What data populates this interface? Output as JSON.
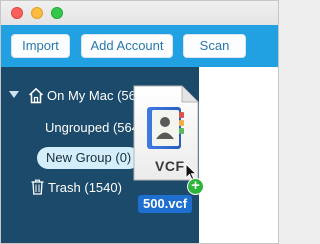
{
  "window": {
    "controls": [
      "close",
      "minimize",
      "zoom"
    ]
  },
  "toolbar": {
    "import_label": "Import",
    "add_account_label": "Add Account",
    "scan_label": "Scan"
  },
  "sidebar": {
    "on_my_mac": {
      "icon": "house-icon",
      "label": "On My Mac (56"
    },
    "items": [
      {
        "label": "Ungrouped (564"
      },
      {
        "label": "New Group (0)",
        "selected": true
      }
    ],
    "trash": {
      "icon": "trash-icon",
      "label": "Trash (1540)"
    }
  },
  "drag": {
    "document_label": "VCF",
    "file_name": "500.vcf",
    "badge": "+",
    "doc_icon": "address-book-icon"
  },
  "colors": {
    "toolbar": "#22a1e2",
    "sidebar": "#1c4a6a",
    "selection": "#d5eefc",
    "file_label": "#1e6fd0",
    "add_badge": "#2db43a"
  }
}
